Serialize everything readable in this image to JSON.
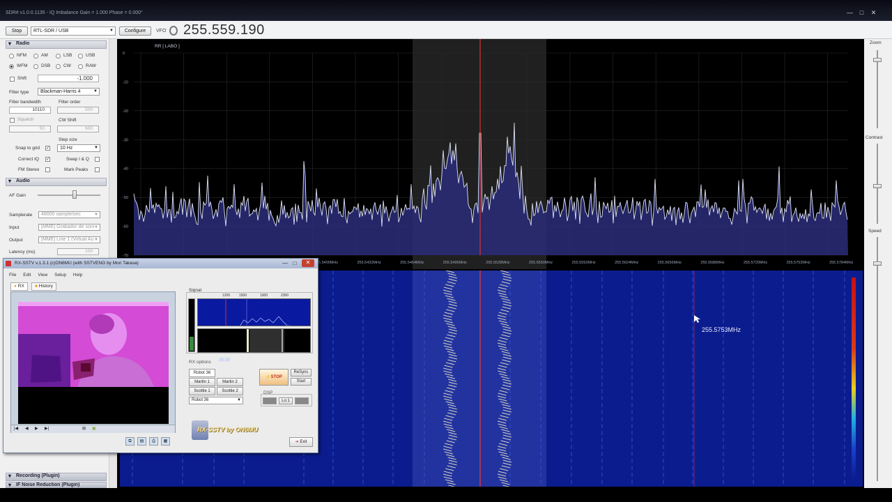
{
  "window": {
    "title": "SDR# v1.0.0.1135 - IQ Imbalance Gain = 1.000 Phase = 0.000°",
    "controls": [
      "—",
      "□",
      "✕"
    ]
  },
  "toolbar": {
    "stop_label": "Stop",
    "source": "RTL-SDR / USB",
    "configure_label": "Configure",
    "vfo_label": "VFO",
    "vfo_frequency": "255.559.190"
  },
  "radio": {
    "header": "Radio",
    "modes": [
      "NFM",
      "AM",
      "LSB",
      "USB",
      "WFM",
      "DSB",
      "CW",
      "RAW"
    ],
    "selected_mode": "USB",
    "shift_label": "Shift",
    "shift_value": "-1.000",
    "filter_type_label": "Filter type",
    "filter_type": "Blackman-Harris 4",
    "filter_bandwidth_label": "Filter bandwidth",
    "filter_bandwidth": "10110",
    "filter_order_label": "Filter order",
    "filter_order": "500",
    "squelch_label": "Squelch",
    "squelch": "50",
    "cw_shift_label": "CW Shift",
    "cw_shift": "600",
    "step_size_label": "Step size",
    "step_size": "10 Hz",
    "snap_label": "Snap to grid",
    "correct_iq_label": "Correct IQ",
    "swap_iq_label": "Swap I & Q",
    "fm_stereo_label": "FM Stereo",
    "mark_peaks_label": "Mark Peaks"
  },
  "audio": {
    "header": "Audio",
    "af_gain_label": "AF Gain",
    "af_gain_level": 0.6,
    "samplerate_label": "Samplerate",
    "samplerate": "48000 sample/sec",
    "input_label": "Input",
    "input": "[MME] Grabador de soni",
    "output_label": "Output",
    "output": "[MME] Line 1 (Virtual Au",
    "latency_label": "Latency (ms)",
    "latency": "100"
  },
  "bottom_panels": [
    "Recording (Plugin)",
    "IF Noise Reduction (Plugin)"
  ],
  "right_panel": {
    "zoom_label": "Zoom",
    "contrast_label": "Contrast",
    "speed_label": "Speed",
    "zoom_level": 0.1,
    "contrast_level": 0.5,
    "speed_level": 0.1
  },
  "spectrum": {
    "db_labels": [
      "0",
      "-10",
      "-20",
      "-30",
      "-40",
      "-50",
      "-60",
      "-70"
    ],
    "freq_labels": [
      "255.5400MHz",
      "255.5432MHz",
      "255.5464MHz",
      "255.5496MHz",
      "255.5528MHz",
      "255.5560MHz",
      "255.5592MHz",
      "255.5624MHz",
      "255.5656MHz",
      "255.5688MHz",
      "255.5720MHz",
      "255.5752MHz",
      "255.5784MHz",
      "255.5816MHz",
      "255.5848MHz"
    ],
    "corner_label": "RR [ LABO ]"
  },
  "waterfall": {
    "cursor_frequency": "255.5753MHz"
  },
  "rx_sstv": {
    "title": "RX-SSTV v.1.3.1 (c)ON6MU (with SSTVENG by Mori Takasa)",
    "menu": [
      "File",
      "Edit",
      "View",
      "Setup",
      "Help"
    ],
    "tabs": [
      "RX",
      "History"
    ],
    "signal_label": "Signal",
    "signal_ticks": [
      "1200",
      "1500",
      "1900",
      "2300"
    ],
    "rx_options_label": "RX options",
    "modes": [
      "Robot 36",
      "Martin 1",
      "Martin 2",
      "Scottie 1",
      "Scottie 2"
    ],
    "mode_select": "Robot 36",
    "stop_label": "STOP",
    "resync_label": "ReSync",
    "start_label": "Start",
    "dsp_label": "DSP",
    "dsp_buttons": [
      "",
      "Lo:1",
      ""
    ],
    "logo_text": "RX-SSTV by ON6MU",
    "exit_label": "Exit"
  }
}
